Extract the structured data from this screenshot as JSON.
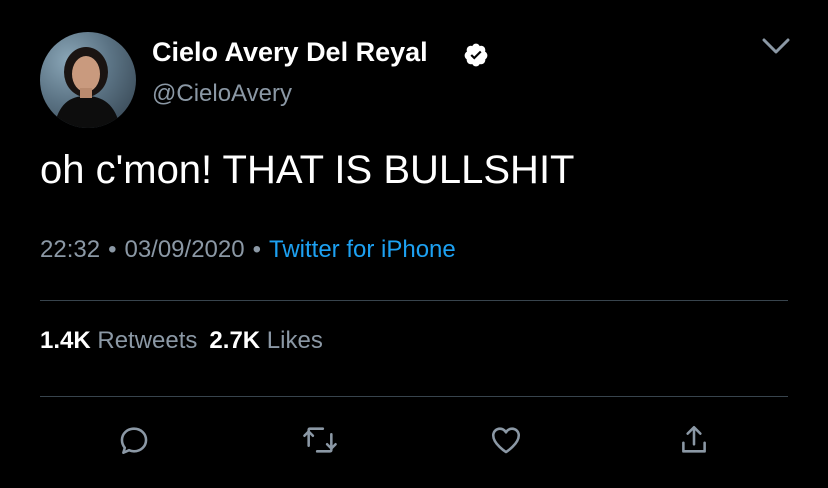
{
  "user": {
    "display_name": "Cielo Avery Del Reyal",
    "handle": "@CieloAvery",
    "verified": true
  },
  "tweet": {
    "text": "oh c'mon! THAT IS BULLSHIT"
  },
  "meta": {
    "time": "22:32",
    "separator": "•",
    "date": "03/09/2020",
    "source": "Twitter for iPhone"
  },
  "stats": {
    "retweets_count": "1.4K",
    "retweets_label": "Retweets",
    "likes_count": "2.7K",
    "likes_label": "Likes"
  },
  "icons": {
    "menu": "chevron-down-icon",
    "reply": "reply-icon",
    "retweet": "retweet-icon",
    "like": "heart-icon",
    "share": "share-icon"
  },
  "colors": {
    "background": "#000000",
    "primary_text": "#ffffff",
    "secondary_text": "#8b98a5",
    "link": "#1da1f2",
    "divider": "#38444d"
  }
}
